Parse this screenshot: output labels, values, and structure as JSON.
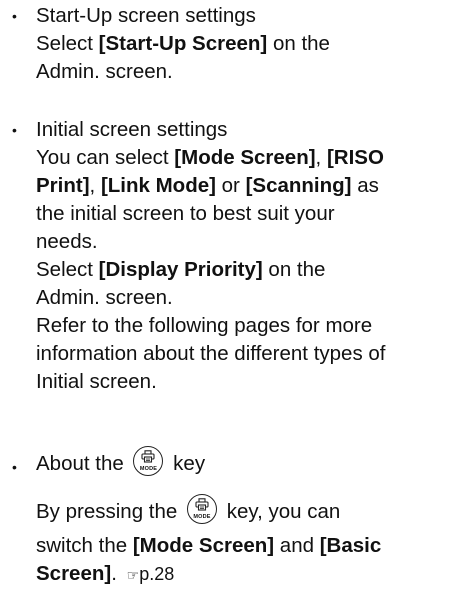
{
  "items": [
    {
      "bullet": "•",
      "title": "Start-Up screen settings",
      "l1_pre": "Select ",
      "l1_bold": "[Start-Up Screen]",
      "l1_post": " on the",
      "l2": "Admin. screen."
    },
    {
      "bullet": "•",
      "title": "Initial screen settings",
      "l1_pre": "You can select ",
      "l1_b1": "[Mode Screen]",
      "l1_sep1": ", ",
      "l1_b2": "[RISO",
      "l2_b2": "Print]",
      "l2_sep": ", ",
      "l2_b3": "[Link Mode]",
      "l2_or": " or ",
      "l2_b4": "[Scanning]",
      "l2_as": " as",
      "l3": "the initial screen to best suit your",
      "l4": "needs.",
      "l5_pre": "Select ",
      "l5_bold": "[Display Priority]",
      "l5_post": " on the",
      "l6": "Admin. screen.",
      "l7": "Refer to the following pages for more",
      "l8": "information about the different types of",
      "l9": "Initial screen."
    },
    {
      "bullet": "•",
      "title_pre": "About the",
      "title_post": "key",
      "key_label": "MODE",
      "key_icon": "mode-key-icon",
      "l1_pre": "By pressing the",
      "l1_post": "key, you can",
      "l2_pre": "switch the ",
      "l2_b1": "[Mode Screen]",
      "l2_and": " and ",
      "l2_b2": "[Basic",
      "l3_b2": "Screen]",
      "l3_dot": ". ",
      "pointer_icon": "pointing-hand-icon",
      "pointer_glyph": "☞",
      "ref": "p.28"
    }
  ]
}
